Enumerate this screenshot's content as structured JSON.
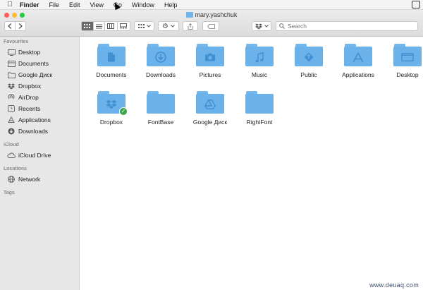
{
  "menubar": {
    "app": "Finder",
    "items": [
      "File",
      "Edit",
      "View",
      "Go",
      "Window",
      "Help"
    ]
  },
  "window": {
    "title": "mary.yashchuk",
    "lights": [
      "#fc5d56",
      "#fdbc2e",
      "#28c840"
    ]
  },
  "toolbar": {
    "search_placeholder": "Search"
  },
  "sidebar": {
    "favourites_title": "Favourites",
    "favourites": [
      {
        "label": "Desktop",
        "icon": "desktop-icon"
      },
      {
        "label": "Documents",
        "icon": "documents-icon"
      },
      {
        "label": "Google Диск",
        "icon": "folder-icon"
      },
      {
        "label": "Dropbox",
        "icon": "dropbox-icon"
      },
      {
        "label": "AirDrop",
        "icon": "airdrop-icon"
      },
      {
        "label": "Recents",
        "icon": "clock-icon"
      },
      {
        "label": "Applications",
        "icon": "applications-icon"
      },
      {
        "label": "Downloads",
        "icon": "download-icon"
      }
    ],
    "icloud_title": "iCloud",
    "icloud": [
      {
        "label": "iCloud Drive",
        "icon": "cloud-icon"
      }
    ],
    "locations_title": "Locations",
    "locations": [
      {
        "label": "Network",
        "icon": "globe-icon"
      }
    ],
    "tags_title": "Tags"
  },
  "folders": [
    {
      "label": "Documents",
      "glyph": "document"
    },
    {
      "label": "Downloads",
      "glyph": "download"
    },
    {
      "label": "Pictures",
      "glyph": "camera"
    },
    {
      "label": "Music",
      "glyph": "music"
    },
    {
      "label": "Public",
      "glyph": "public"
    },
    {
      "label": "Applications",
      "glyph": "apps"
    },
    {
      "label": "Desktop",
      "glyph": "desktop"
    },
    {
      "label": "Dropbox",
      "glyph": "dropbox",
      "synced": true
    },
    {
      "label": "FontBase",
      "glyph": "none"
    },
    {
      "label": "Google Диск",
      "glyph": "drive"
    },
    {
      "label": "RightFont",
      "glyph": "none"
    }
  ],
  "colors": {
    "folder": "#6cb2ea",
    "folder_glyph": "#3f8fd2",
    "synced_badge": "#3aa345"
  },
  "watermark": "www.deuaq.com"
}
